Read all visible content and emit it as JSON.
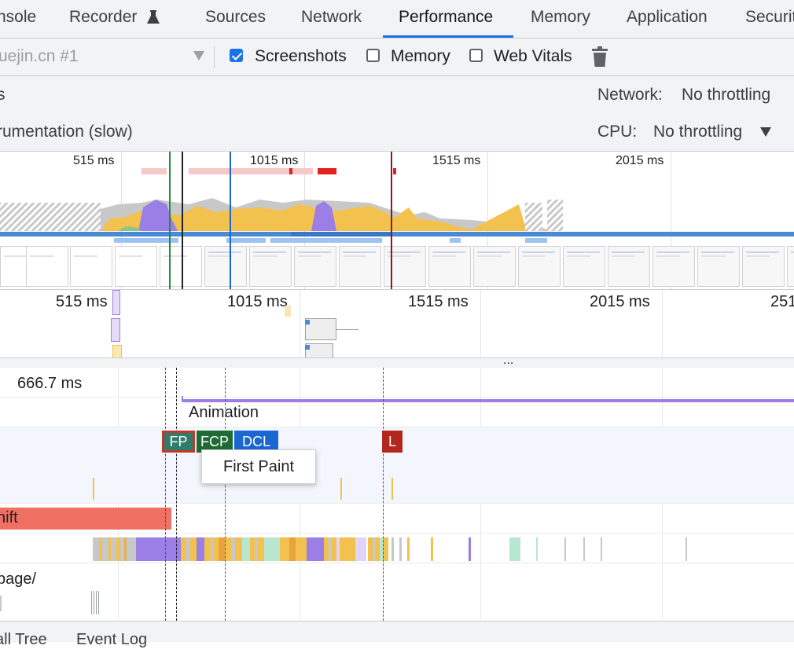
{
  "tabs": [
    {
      "label": "nsole"
    },
    {
      "label": "Recorder"
    },
    {
      "label": "Sources"
    },
    {
      "label": "Network"
    },
    {
      "label": "Performance"
    },
    {
      "label": "Memory"
    },
    {
      "label": "Application"
    },
    {
      "label": "Securit"
    }
  ],
  "active_tab": "Performance",
  "toolbar": {
    "target": "uejin.cn #1",
    "screenshots_label": "Screenshots",
    "screenshots_checked": true,
    "memory_label": "Memory",
    "memory_checked": false,
    "webvitals_label": "Web Vitals",
    "webvitals_checked": false
  },
  "settings": {
    "left_top": "s",
    "left_bottom": "rumentation (slow)",
    "network_label": "Network:",
    "network_value": "No throttling",
    "cpu_label": "CPU:",
    "cpu_value": "No throttling"
  },
  "overview": {
    "labels": [
      "515 ms",
      "1015 ms",
      "1515 ms",
      "2015 ms"
    ]
  },
  "ruler": {
    "labels": [
      "515 ms",
      "1015 ms",
      "1515 ms",
      "2015 ms",
      "251"
    ]
  },
  "splitter_label": "...",
  "timeline": {
    "duration": "666.7 ms",
    "animation_label": "Animation",
    "markers": [
      {
        "label": "FP",
        "color": "#2e7d6b"
      },
      {
        "label": "FCP",
        "color": "#1e6b35"
      },
      {
        "label": "DCL",
        "color": "#1a67d2"
      },
      {
        "label": "L",
        "color": "#b3261e"
      }
    ],
    "tooltip": "First Paint",
    "layout_shift_label": "hift",
    "page_label": "page/"
  },
  "bottom_tabs": [
    {
      "label": "all Tree"
    },
    {
      "label": "Event Log"
    }
  ],
  "colors": {
    "accent": "#1a73e8",
    "scripting": "#f2c14e",
    "rendering": "#9b7fe6",
    "layout_shift": "#f07064"
  }
}
